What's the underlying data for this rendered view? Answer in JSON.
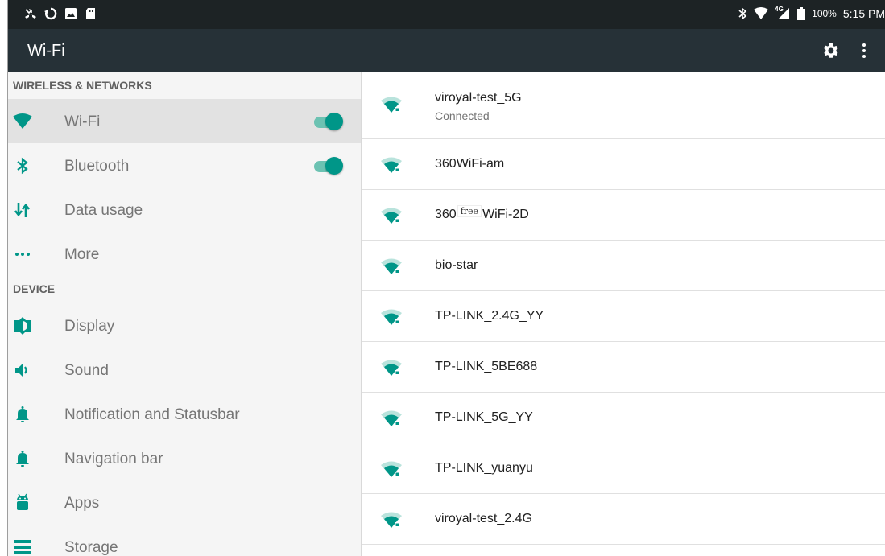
{
  "statusbar": {
    "network_type": "4G",
    "battery": "100%",
    "time": "5:15 PM"
  },
  "toolbar": {
    "title": "Wi-Fi",
    "icons": [
      "gear-icon",
      "more-vert-icon"
    ]
  },
  "sidebar": {
    "sections": {
      "wireless": "WIRELESS & NETWORKS",
      "device": "DEVICE"
    },
    "items": [
      {
        "label": "Wi-Fi",
        "icon": "wifi-icon",
        "toggle": true,
        "selected": true
      },
      {
        "label": "Bluetooth",
        "icon": "bluetooth-icon",
        "toggle": true
      },
      {
        "label": "Data usage",
        "icon": "data-usage-icon"
      },
      {
        "label": "More",
        "icon": "more-horiz-icon"
      },
      {
        "label": "Display",
        "icon": "brightness-icon"
      },
      {
        "label": "Sound",
        "icon": "volume-icon"
      },
      {
        "label": "Notification and Statusbar",
        "icon": "bell-icon"
      },
      {
        "label": "Navigation bar",
        "icon": "bell-icon"
      },
      {
        "label": "Apps",
        "icon": "android-icon"
      },
      {
        "label": "Storage",
        "icon": "storage-icon"
      }
    ]
  },
  "networks": [
    {
      "ssid": "viroyal-test_5G",
      "status": "Connected"
    },
    {
      "ssid": "360WiFi-am"
    },
    {
      "ssid_pre": "360",
      "badge": "free",
      "ssid_post": "WiFi-2D"
    },
    {
      "ssid": "bio-star"
    },
    {
      "ssid": "TP-LINK_2.4G_YY"
    },
    {
      "ssid": "TP-LINK_5BE688"
    },
    {
      "ssid": "TP-LINK_5G_YY"
    },
    {
      "ssid": "TP-LINK_yuanyu"
    },
    {
      "ssid": "viroyal-test_2.4G"
    }
  ],
  "colors": {
    "accent": "#009688",
    "toolbar": "#263137",
    "statusbar": "#1d2325"
  }
}
